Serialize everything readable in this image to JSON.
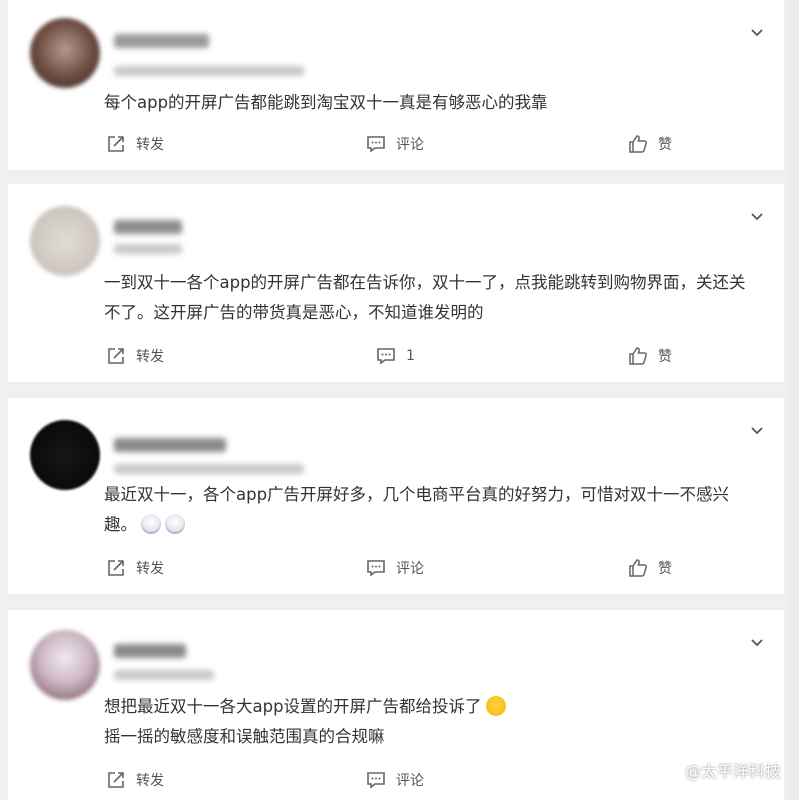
{
  "posts": [
    {
      "content": "每个app的开屏广告都能跳到淘宝双十一真是有够恶心的我靠",
      "repost": "转发",
      "comment": "评论",
      "like": "赞"
    },
    {
      "content": "一到双十一各个app的开屏广告都在告诉你，双十一了，点我能跳转到购物界面，关还关不了。这开屏广告的带货真是恶心，不知道谁发明的",
      "repost": "转发",
      "comment": "1",
      "like": "赞"
    },
    {
      "content": "最近双十一，各个app广告开屏好多，几个电商平台真的好努力，可惜对双十一不感兴趣。",
      "repost": "转发",
      "comment": "评论",
      "like": "赞"
    },
    {
      "content": "想把最近双十一各大app设置的开屏广告都给投诉了",
      "content_line2": "摇一摇的敏感度和误触范围真的合规嘛",
      "repost": "转发",
      "comment": "评论",
      "like": "赞"
    }
  ],
  "watermark": "@太平洋科技"
}
